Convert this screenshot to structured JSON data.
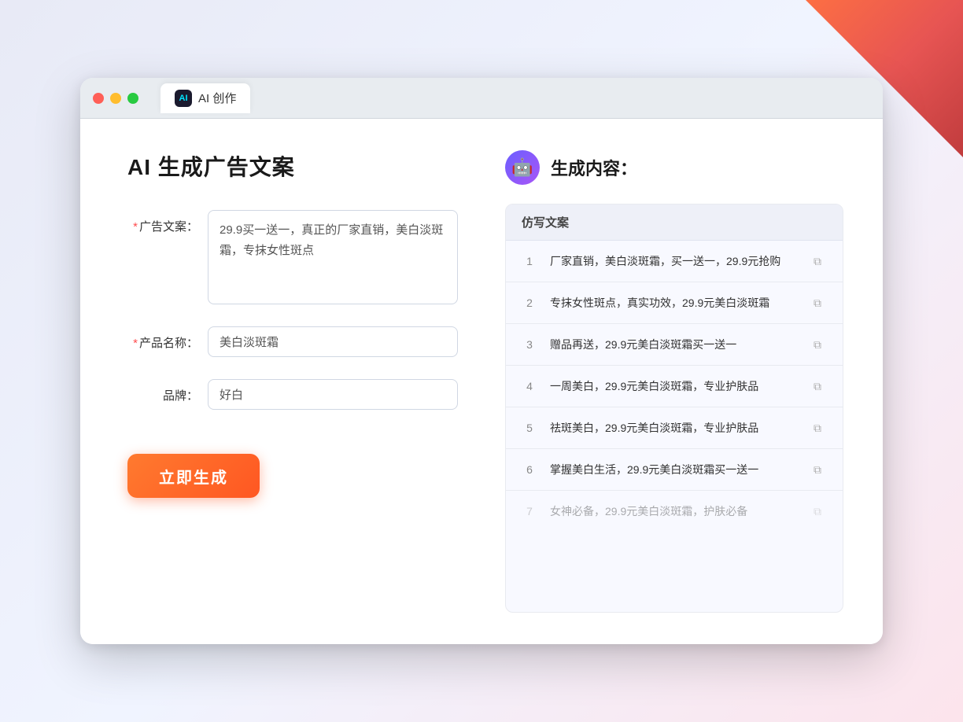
{
  "browser": {
    "tab_title": "AI 创作",
    "tab_icon_label": "AI"
  },
  "left_panel": {
    "page_title": "AI 生成广告文案",
    "form": {
      "ad_label": "广告文案：",
      "ad_required": "*",
      "ad_value": "29.9买一送一，真正的厂家直销，美白淡斑霜，专抹女性斑点",
      "product_label": "产品名称：",
      "product_required": "*",
      "product_value": "美白淡斑霜",
      "brand_label": "品牌：",
      "brand_value": "好白"
    },
    "generate_button": "立即生成"
  },
  "right_panel": {
    "result_title": "生成内容：",
    "table_header": "仿写文案",
    "items": [
      {
        "num": "1",
        "text": "厂家直销，美白淡斑霜，买一送一，29.9元抢购",
        "faded": false
      },
      {
        "num": "2",
        "text": "专抹女性斑点，真实功效，29.9元美白淡斑霜",
        "faded": false
      },
      {
        "num": "3",
        "text": "赠品再送，29.9元美白淡斑霜买一送一",
        "faded": false
      },
      {
        "num": "4",
        "text": "一周美白，29.9元美白淡斑霜，专业护肤品",
        "faded": false
      },
      {
        "num": "5",
        "text": "祛斑美白，29.9元美白淡斑霜，专业护肤品",
        "faded": false
      },
      {
        "num": "6",
        "text": "掌握美白生活，29.9元美白淡斑霜买一送一",
        "faded": false
      },
      {
        "num": "7",
        "text": "女神必备，29.9元美白淡斑霜，护肤必备",
        "faded": true
      }
    ]
  }
}
